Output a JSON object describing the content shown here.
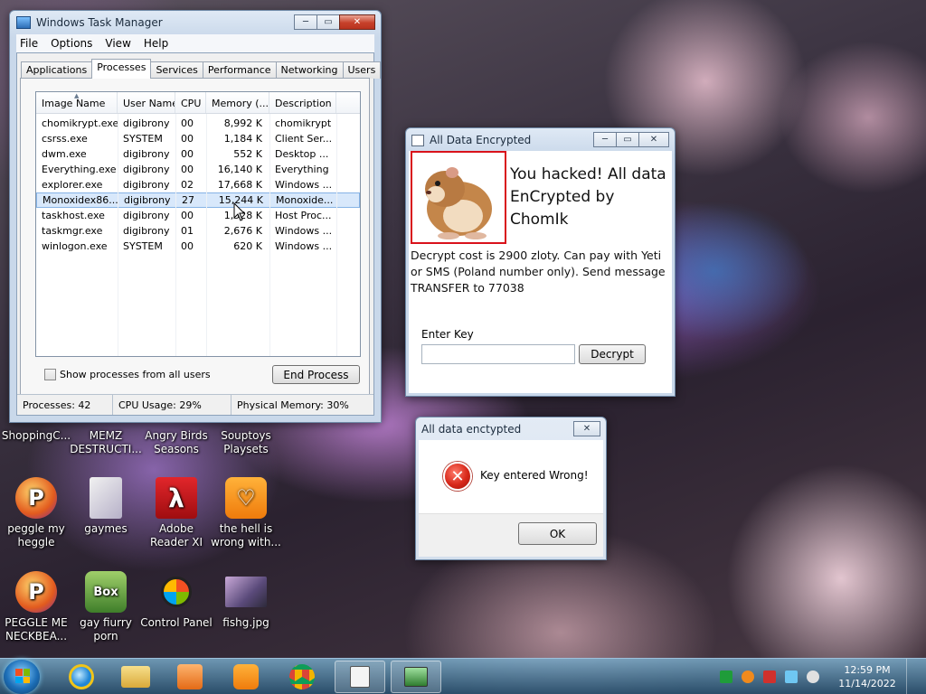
{
  "taskmgr": {
    "title": "Windows Task Manager",
    "menu": [
      "File",
      "Options",
      "View",
      "Help"
    ],
    "tabs": [
      "Applications",
      "Processes",
      "Services",
      "Performance",
      "Networking",
      "Users"
    ],
    "columns": [
      "Image Name",
      "User Name",
      "CPU",
      "Memory (...",
      "Description"
    ],
    "rows": [
      {
        "image": "chomikrypt.exe",
        "user": "digibrony",
        "cpu": "00",
        "memory": "8,992 K",
        "desc": "chomikrypt"
      },
      {
        "image": "csrss.exe",
        "user": "SYSTEM",
        "cpu": "00",
        "memory": "1,184 K",
        "desc": "Client Ser..."
      },
      {
        "image": "dwm.exe",
        "user": "digibrony",
        "cpu": "00",
        "memory": "552 K",
        "desc": "Desktop ..."
      },
      {
        "image": "Everything.exe",
        "user": "digibrony",
        "cpu": "00",
        "memory": "16,140 K",
        "desc": "Everything"
      },
      {
        "image": "explorer.exe",
        "user": "digibrony",
        "cpu": "02",
        "memory": "17,668 K",
        "desc": "Windows ..."
      },
      {
        "image": "Monoxidex86....",
        "user": "digibrony",
        "cpu": "27",
        "memory": "15,244 K",
        "desc": "Monoxide..."
      },
      {
        "image": "taskhost.exe",
        "user": "digibrony",
        "cpu": "00",
        "memory": "1,528 K",
        "desc": "Host Proc..."
      },
      {
        "image": "taskmgr.exe",
        "user": "digibrony",
        "cpu": "01",
        "memory": "2,676 K",
        "desc": "Windows ..."
      },
      {
        "image": "winlogon.exe",
        "user": "SYSTEM",
        "cpu": "00",
        "memory": "620 K",
        "desc": "Windows ..."
      }
    ],
    "show_all_label": "Show processes from all users",
    "end_process_label": "End Process",
    "status": {
      "processes": "Processes: 42",
      "cpu": "CPU Usage: 29%",
      "memory": "Physical Memory: 30%"
    }
  },
  "ransom": {
    "title": "All Data Encrypted",
    "headline": "You hacked! All data EnCrypted by ChomIk",
    "message": "Decrypt cost is 2900 zloty. Can pay with Yeti or SMS (Poland number only). Send message TRANSFER to 77038",
    "key_label": "Enter Key",
    "key_value": "",
    "decrypt_label": "Decrypt"
  },
  "error_dialog": {
    "title": "All data enctypted",
    "message": "Key entered Wrong!",
    "ok_label": "OK"
  },
  "desktop": {
    "top_labels": [
      "ShoppingC...",
      "MEMZ DESTRUCTI...",
      "Angry Birds Seasons",
      "Souptoys Playsets"
    ],
    "row1": [
      {
        "label": "peggle my heggle",
        "icon": "peggle-icon"
      },
      {
        "label": "gaymes",
        "icon": "folder-icon"
      },
      {
        "label": "Adobe Reader XI",
        "icon": "adobe-reader-icon"
      },
      {
        "label": "the hell is wrong with...",
        "icon": "uc-browser-icon"
      }
    ],
    "row2": [
      {
        "label": "PEGGLE ME NECKBEA...",
        "icon": "peggle-icon"
      },
      {
        "label": "gay fiurry porn",
        "icon": "box-icon"
      },
      {
        "label": "Control Panel",
        "icon": "control-panel-icon"
      },
      {
        "label": "fishg.jpg",
        "icon": "image-file-icon"
      }
    ]
  },
  "taskbar": {
    "time": "12:59 PM",
    "date": "11/14/2022"
  },
  "colors": {
    "close_red": "#c7412b",
    "selection": "#d8e8fb",
    "hamster_border": "#d9121b"
  }
}
